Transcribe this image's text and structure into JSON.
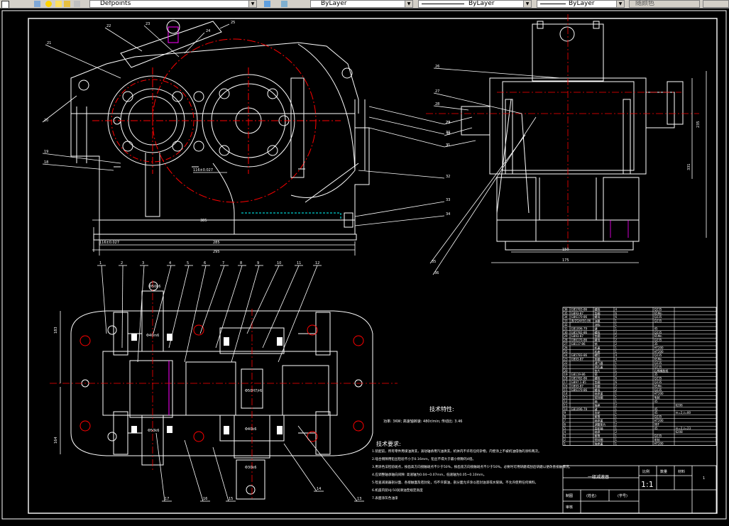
{
  "toolbar": {
    "layer_name": "Defpoints",
    "color": "ByLayer",
    "linetype": "ByLayer",
    "lineweight": "ByLayer",
    "plotstyle": "随颜色"
  },
  "front_view": {
    "callouts_left": [
      "21",
      "22",
      "23",
      "24",
      "20",
      "19",
      "18"
    ],
    "callouts_right": [
      "25",
      "29",
      "30",
      "31",
      "32",
      "33",
      "34"
    ],
    "dims": [
      "285",
      "295",
      "17.5",
      "385",
      "116±0.027"
    ]
  },
  "side_view": {
    "callouts": [
      "26",
      "27",
      "28",
      "29",
      "30",
      "31",
      "35",
      "36"
    ],
    "dims": [
      "235",
      "331",
      "150",
      "175"
    ]
  },
  "top_view": {
    "callouts_top": [
      "1",
      "2",
      "3",
      "4",
      "5",
      "6",
      "7",
      "8",
      "9",
      "10",
      "11",
      "12"
    ],
    "callouts_bottom": [
      "17",
      "16",
      "15",
      "14",
      "13"
    ],
    "dims": [
      "183",
      "164",
      "Φ50k6",
      "Φ40m6",
      "Φ50k6",
      "Φ50H7/r6",
      "Φ40k6",
      "Φ30k6"
    ]
  },
  "specs": {
    "title": "技术特性:",
    "line": "功率: 3KW; 高速轴转速: 480r/min; 传动比: 3.46"
  },
  "requirements": {
    "title": "技术要求:",
    "items": [
      "1.装配前，所有零件用煤油清洗，滚动轴承用汽油清洗，机体内不许有任何杂物，内壁涂上不被机油侵蚀的涂料两次。",
      "2.啮合侧隙用铅丝检验不小于0.16mm，铅丝不得大于最小侧隙的4倍。",
      "3.用涂色法检验斑点，按齿高方向接触斑点不少于50%，按齿宽方向接触斑点不少于50%。必要时可用研磨或刮后研磨以便改善接触情况。",
      "4.应调整轴承轴向间隙: 高速轴为0.04~0.07mm，低速轴为0.05~0.10mm。",
      "5.检查减速器剖分面、各接触面及密封处，均不许漏油，剖分面允许涂以密封油漆或水玻璃，不允许使用任何填料。",
      "6.机座内装HJ-50润滑油至规定高度",
      "7.表面涂灰色油漆"
    ]
  },
  "title_block": {
    "name": "一级减速器",
    "scale_label": "比例",
    "qty_label": "数量",
    "material_label": "材料",
    "scale": "1:1",
    "sheet": "1",
    "drawn_label": "制图",
    "drawn_name": "(姓名)",
    "drawn_no": "(学号)",
    "checked_label": "审核"
  },
  "parts_list": {
    "numbers": [
      "36",
      "35",
      "34",
      "33",
      "32",
      "31",
      "30",
      "29",
      "28",
      "27",
      "26",
      "25",
      "24",
      "23",
      "22",
      "21",
      "20",
      "19",
      "18",
      "17",
      "16",
      "15",
      "14",
      "13",
      "12",
      "11",
      "10",
      "9",
      "8",
      "7",
      "6",
      "5",
      "4",
      "3",
      "2",
      "1"
    ],
    "codes": [
      "GB5783-86",
      "GB93-87",
      "GB6170-86",
      "JB/ZQ4450-86",
      "",
      "GB1096-79",
      "GB5782-86",
      "GB93-87",
      "GB6170-86",
      "GB117-86",
      "",
      "",
      "GB5783-86",
      "GB93-87",
      "",
      "",
      "",
      "GB119-86",
      "GB5782-86",
      "GB97.1-85",
      "GB93-87",
      "GB6170-86",
      "",
      "",
      "",
      "",
      "GB1096-79",
      "",
      "",
      "",
      "",
      "",
      "",
      "",
      "",
      ""
    ],
    "names": [
      "螺栓",
      "垫圈",
      "螺母",
      "油塞",
      "油标",
      "键",
      "螺栓",
      "垫圈",
      "螺母",
      "销",
      "机盖",
      "机座",
      "螺钉",
      "垫圈",
      "通气器",
      "视孔盖",
      "垫片",
      "销",
      "螺栓",
      "垫圈",
      "垫圈",
      "螺母",
      "轴承盖",
      "密封圈",
      "轴",
      "轴承",
      "键",
      "齿轮",
      "套筒",
      "轴承盖",
      "调整垫片",
      "齿轮轴",
      "轴承",
      "套筒",
      "密封圈",
      "轴承盖"
    ],
    "qtys": [
      "4",
      "6",
      "6",
      "1",
      "1",
      "1",
      "2",
      "2",
      "2",
      "2",
      "1",
      "1",
      "4",
      "4",
      "1",
      "1",
      "1",
      "2",
      "6",
      "6",
      "2",
      "2",
      "1",
      "1",
      "1",
      "2",
      "1",
      "1",
      "1",
      "1",
      "2",
      "1",
      "2",
      "1",
      "1",
      "1"
    ],
    "materials": [
      "Q235",
      "65Mn",
      "Q235",
      "Q235",
      "",
      "45",
      "Q235",
      "65Mn",
      "Q235",
      "35",
      "HT200",
      "HT200",
      "Q235",
      "65Mn",
      "Q235",
      "Q235",
      "石棉橡胶纸",
      "35",
      "Q235",
      "Q235",
      "65Mn",
      "Q235",
      "HT200",
      "毛毡",
      "45",
      "",
      "45",
      "45",
      "Q235",
      "HT200",
      "08F",
      "45",
      "",
      "Q235",
      "毛毡",
      "HT200"
    ],
    "notes": [
      "",
      "",
      "",
      "",
      "",
      "",
      "",
      "",
      "",
      "",
      "",
      "",
      "",
      "",
      "",
      "",
      "",
      "",
      "",
      "",
      "",
      "",
      "",
      "",
      "",
      "6206",
      "",
      "m=2,z=80",
      "",
      "",
      "",
      "m=2,z=23",
      "6208",
      "",
      "",
      ""
    ]
  }
}
